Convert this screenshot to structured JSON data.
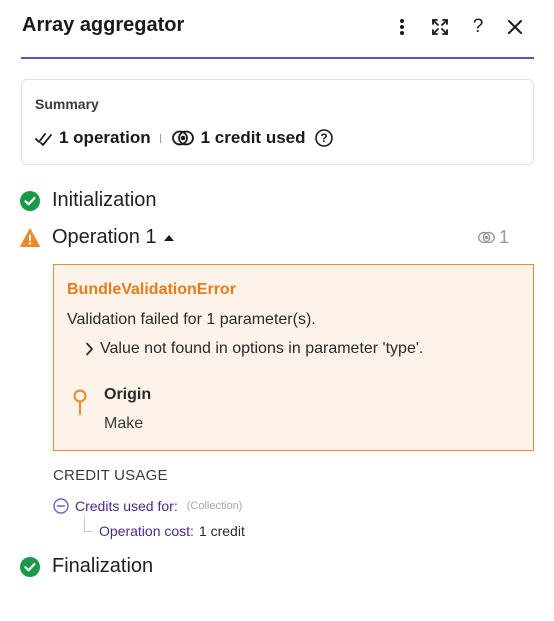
{
  "header": {
    "title": "Array aggregator",
    "help_label": "?"
  },
  "summary": {
    "label": "Summary",
    "operations": "1 operation",
    "credits": "1 credit used"
  },
  "steps": {
    "initialization": "Initialization",
    "operation": "Operation 1",
    "operation_credits": "1",
    "finalization": "Finalization"
  },
  "error": {
    "title": "BundleValidationError",
    "message": "Validation failed for 1 parameter(s).",
    "detail": "Value not found in options in parameter 'type'.",
    "origin_label": "Origin",
    "origin_value": "Make"
  },
  "credit_usage": {
    "heading": "CREDIT USAGE",
    "credits_used_for": "Credits used for:",
    "collection": "(Collection)",
    "operation_cost_label": "Operation cost:",
    "operation_cost_value": "1 credit"
  },
  "colors": {
    "accent": "#6b4fbf",
    "success": "#1a9a47",
    "warning": "#ec8b2c",
    "link": "#4a2a8c"
  },
  "icons": [
    "more-vertical-icon",
    "expand-icon",
    "help-icon",
    "close-icon",
    "double-check-icon",
    "credit-eye-icon",
    "help-circle-icon",
    "check-circle-icon",
    "warning-triangle-icon",
    "caret-up-icon",
    "chevron-right-icon",
    "origin-pin-icon",
    "minus-circle-icon"
  ]
}
